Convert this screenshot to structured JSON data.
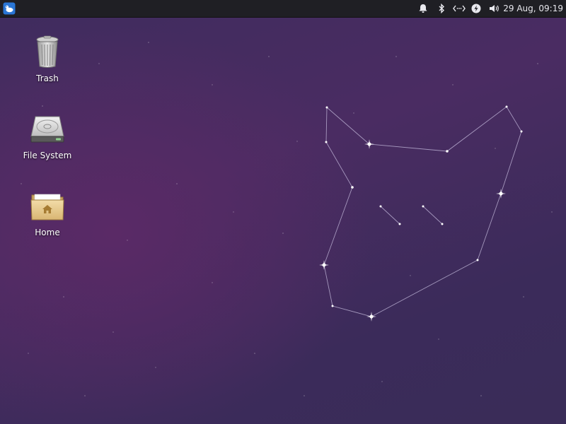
{
  "panel": {
    "clock": "29 Aug, 09:19",
    "icons": [
      "xfce-menu-icon",
      "notification-bell-icon",
      "bluetooth-icon",
      "network-icon",
      "power-icon",
      "volume-icon"
    ]
  },
  "desktop": {
    "icons": [
      {
        "label": "Trash",
        "icon": "trash-icon"
      },
      {
        "label": "File System",
        "icon": "hard-drive-icon"
      },
      {
        "label": "Home",
        "icon": "home-folder-icon"
      }
    ]
  },
  "colors": {
    "panel_bg": "#1f1f24",
    "wallpaper_base": "#3f2c5e",
    "wallpaper_glow": "#5a2a66",
    "accent_blue": "#2a76d6"
  }
}
